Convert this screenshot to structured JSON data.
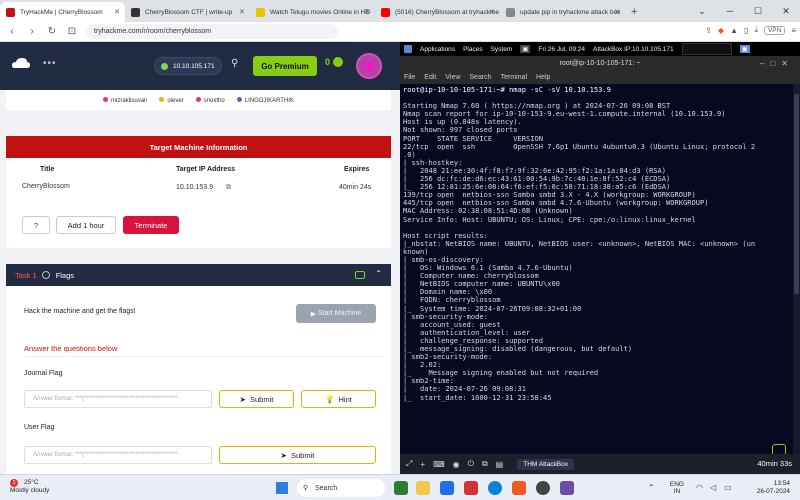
{
  "browser": {
    "tabs": [
      {
        "title": "TryHackMe | CherryBlossom",
        "color": "#c11111",
        "active": true
      },
      {
        "title": "CherryBlossom CTF | write-up",
        "color": "#333333",
        "active": false
      },
      {
        "title": "Watch Telugu movies Online in HD",
        "color": "#e5c400",
        "active": false
      },
      {
        "title": "(5016) CherryBlossom at tryhackme",
        "color": "#ff0000",
        "active": false
      },
      {
        "title": "update pip in tryhackme attack box",
        "color": "#888888",
        "active": false
      }
    ],
    "url": "tryhackme.com/r/room/cherryblossom",
    "vpn_label": "VPN"
  },
  "thm": {
    "ip_pill": "10.10.105.171",
    "premium_label": "Go Premium",
    "streak": "0",
    "users": [
      {
        "name": "mizraklisuvan",
        "color": "#e0338a"
      },
      {
        "name": "olever",
        "color": "#e8b500"
      },
      {
        "name": "snoxtho",
        "color": "#e0338a"
      },
      {
        "name": "LINGOJIKARTHIK",
        "color": "#7a4cd8"
      }
    ],
    "target": {
      "header": "Target Machine Information",
      "col_title": "Title",
      "col_ip": "Target IP Address",
      "col_expires": "Expires",
      "title": "CherryBlossom",
      "ip": "10.10.153.9",
      "expires": "40min 24s",
      "help_label": "?",
      "add_hour_label": "Add 1 hour",
      "terminate_label": "Terminate"
    },
    "task": {
      "number": "Task 1",
      "name": "Flags",
      "text": "Hack the machine and get the flags!",
      "start_label": "Start Machine",
      "answer_heading": "Answer the questions below",
      "q1_label": "Journal Flag",
      "q1_placeholder": "Answer format: ***{****************************************",
      "q2_label": "User Flag",
      "q2_placeholder": "Answer format: ***{****************************************",
      "submit_label": "Submit",
      "hint_label": "Hint"
    }
  },
  "terminal": {
    "topbar_apps": "Applications",
    "topbar_places": "Places",
    "topbar_system": "System",
    "topbar_date": "Fri 26 Jul, 09:24",
    "topbar_ab": "AttackBox IP:10.10.105.171",
    "title": "root@ip-10-10-105-171: ~",
    "menu": [
      "File",
      "Edit",
      "View",
      "Search",
      "Terminal",
      "Help"
    ],
    "lines": [
      "root@ip-10-10-105-171:~# nmap -sC -sV 10.10.153.9",
      "",
      "Starting Nmap 7.60 ( https://nmap.org ) at 2024-07-26 09:08 BST",
      "Nmap scan report for ip-10-10-153-9.eu-west-1.compute.internal (10.10.153.9)",
      "Host is up (0.048s latency).",
      "Not shown: 997 closed ports",
      "PORT    STATE SERVICE     VERSION",
      "22/tcp  open  ssh         OpenSSH 7.6p1 Ubuntu 4ubuntu0.3 (Ubuntu Linux; protocol 2",
      ".0)",
      "| ssh-hostkey:",
      "|   2048 21:ee:30:4f:f8:f7:9f:32:6e:42:95:f2:1a:1a:04:d3 (RSA)",
      "|   256 dc:fc:de:d6:ec:43:61:00:54:9b:7c:40:1e:8f:52:c4 (ECDSA)",
      "|_  256 12:81:25:6e:08:64:f6:ef:f5:0c:58:71:18:38:a5:c6 (EdDSA)",
      "139/tcp open  netbios-ssn Samba smbd 3.X - 4.X (workgroup: WORKGROUP)",
      "445/tcp open  netbios-ssn Samba smbd 4.7.6-Ubuntu (workgroup: WORKGROUP)",
      "MAC Address: 02:38:08:51:4D:6B (Unknown)",
      "Service Info: Host: UBUNTU; OS: Linux; CPE: cpe:/o:linux:linux_kernel",
      "",
      "Host script results:",
      "|_nbstat: NetBIOS name: UBUNTU, NetBIOS user: <unknown>, NetBIOS MAC: <unknown> (un",
      "known)",
      "| smb-os-discovery:",
      "|   OS: Windows 6.1 (Samba 4.7.6-Ubuntu)",
      "|   Computer name: cherryblossom",
      "|   NetBIOS computer name: UBUNTU\\x00",
      "|   Domain name: \\x00",
      "|   FQDN: cherryblossom",
      "|_  System time: 2024-07-26T09:08:32+01:00",
      "| smb-security-mode:",
      "|   account_used: guest",
      "|   authentication_level: user",
      "|   challenge_response: supported",
      "|_  message_signing: disabled (dangerous, but default)",
      "| smb2-security-mode:",
      "|   2.02:",
      "|_    Message signing enabled but not required",
      "| smb2-time:",
      "|   date: 2024-07-26 09:08:31",
      "|_  start_date: 1600-12-31 23:58:45"
    ],
    "footer_tab": "THM AttackBox",
    "time_left": "40min 33s"
  },
  "taskbar": {
    "weather_temp": "25°C",
    "weather_desc": "Mostly cloudy",
    "weather_badge": "1",
    "search_label": "Search",
    "lang1": "ENG",
    "lang2": "IN",
    "time": "13:54",
    "date": "26-07-2024"
  }
}
